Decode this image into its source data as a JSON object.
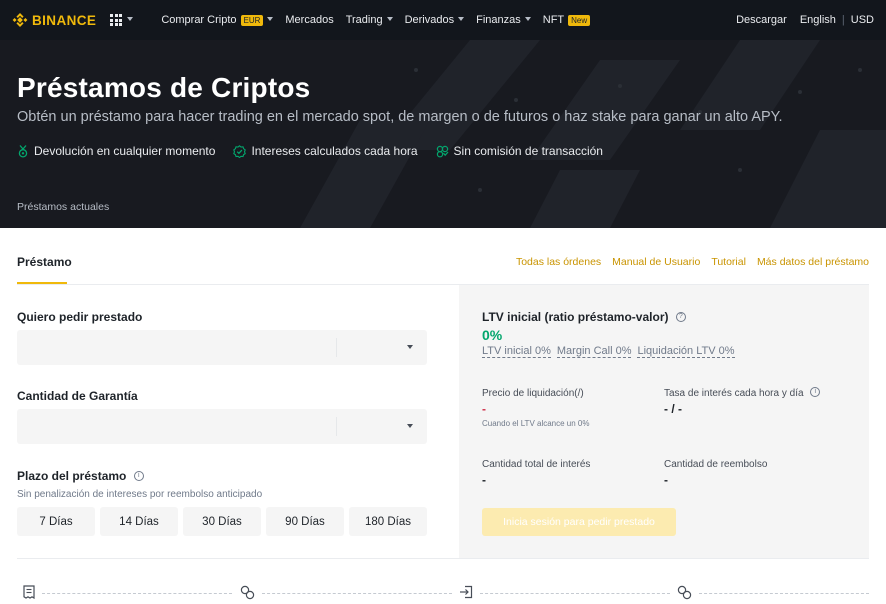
{
  "nav": {
    "brand": "BINANCE",
    "items": [
      {
        "label": "Comprar Cripto",
        "badge": "EUR",
        "caret": true
      },
      {
        "label": "Mercados",
        "caret": false
      },
      {
        "label": "Trading",
        "caret": true
      },
      {
        "label": "Derivados",
        "caret": true
      },
      {
        "label": "Finanzas",
        "caret": true
      },
      {
        "label": "NFT",
        "badge": "New",
        "caret": false
      }
    ],
    "right": {
      "download": "Descargar",
      "language": "English",
      "currency": "USD"
    }
  },
  "hero": {
    "title": "Préstamos de Criptos",
    "subtitle": "Obtén un préstamo para hacer trading en el mercado spot, de margen o de futuros o haz stake para ganar un alto APY.",
    "features": [
      {
        "icon": "medal-icon",
        "label": "Devolución en cualquier momento"
      },
      {
        "icon": "check-circle-icon",
        "label": "Intereses calculados cada hora"
      },
      {
        "icon": "coins-icon",
        "label": "Sin comisión de transacción"
      }
    ],
    "tab": "Préstamos actuales"
  },
  "panel": {
    "tab": "Préstamo",
    "links": [
      "Todas las órdenes",
      "Manual de Usuario",
      "Tutorial",
      "Más datos del préstamo"
    ]
  },
  "form": {
    "borrow_label": "Quiero pedir prestado",
    "collateral_label": "Cantidad de Garantía",
    "term_label": "Plazo del préstamo",
    "term_hint": "Sin penalización de intereses por reembolso anticipado",
    "terms": [
      "7 Días",
      "14 Días",
      "30 Días",
      "90 Días",
      "180 Días"
    ]
  },
  "summary": {
    "ltv_title": "LTV inicial (ratio préstamo-valor)",
    "ltv_value": "0%",
    "ltv_links": [
      "LTV inicial 0%",
      "Margin Call 0%",
      "Liquidación LTV 0%"
    ],
    "liq_price_label": "Precio de liquidación(/)",
    "liq_price_value": "-",
    "liq_price_note": "Cuando el LTV alcance un 0%",
    "rate_label": "Tasa de interés cada hora y día",
    "rate_value": "- / -",
    "total_interest_label": "Cantidad total de interés",
    "total_interest_value": "-",
    "repay_label": "Cantidad de reembolso",
    "repay_value": "-",
    "login_button": "Inicia sesión para pedir prestado"
  },
  "colors": {
    "brand": "#f0b90b",
    "positive": "#03a66d",
    "negative": "#cf304a"
  }
}
